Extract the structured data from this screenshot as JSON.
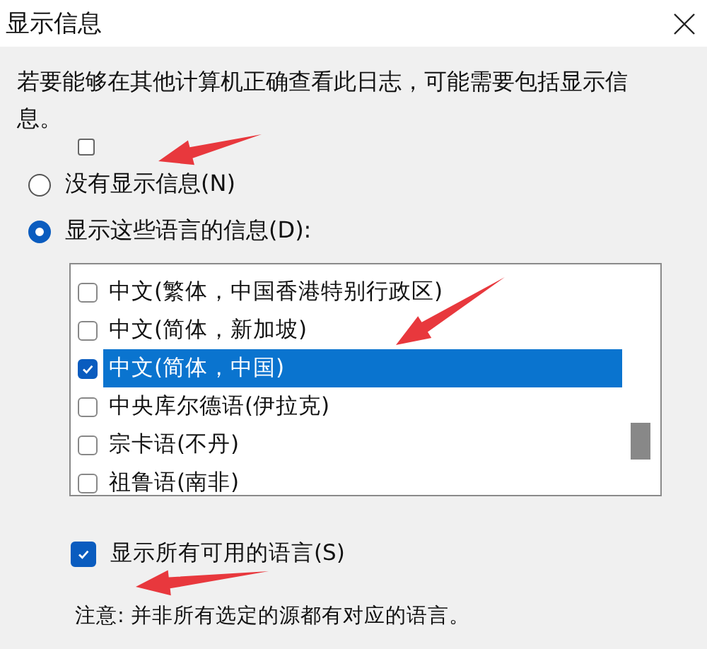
{
  "window": {
    "title": "显示信息"
  },
  "intro": "若要能够在其他计算机正确查看此日志，可能需要包括显示信息。",
  "options": [
    {
      "label": "没有显示信息(N)",
      "selected": false
    },
    {
      "label": "显示这些语言的信息(D):",
      "selected": true
    }
  ],
  "languages": [
    {
      "label": "中文(繁体，中国香港特别行政区)",
      "checked": false,
      "selected": false
    },
    {
      "label": "中文(简体，新加坡)",
      "checked": false,
      "selected": false
    },
    {
      "label": "中文(简体，中国)",
      "checked": true,
      "selected": true
    },
    {
      "label": "中央库尔德语(伊拉克)",
      "checked": false,
      "selected": false
    },
    {
      "label": "宗卡语(不丹)",
      "checked": false,
      "selected": false
    },
    {
      "label": "祖鲁语(南非)",
      "checked": false,
      "selected": false
    }
  ],
  "show_all": {
    "label": "显示所有可用的语言(S)",
    "checked": true
  },
  "note": "注意: 并非所有选定的源都有对应的语言。"
}
